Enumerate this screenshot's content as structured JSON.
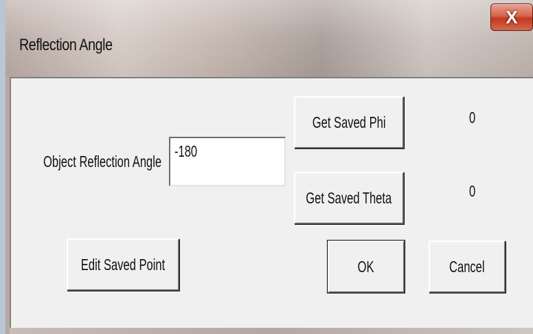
{
  "window": {
    "title": "Reflection Angle",
    "close_label": "X"
  },
  "form": {
    "angle_label": "Object Reflection Angle",
    "angle_value": "-180"
  },
  "buttons": {
    "get_saved_phi": "Get Saved Phi",
    "get_saved_theta": "Get Saved Theta",
    "edit_saved_point": "Edit Saved Point",
    "ok": "OK",
    "cancel": "Cancel"
  },
  "values": {
    "phi": "0",
    "theta": "0"
  },
  "colors": {
    "close_button": "#c2381f",
    "dialog_face": "#f0f0f0"
  }
}
